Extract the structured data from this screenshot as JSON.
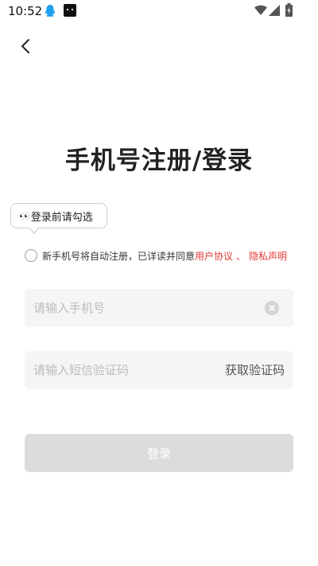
{
  "status_bar": {
    "time": "10:52",
    "icons": [
      "qq-icon",
      "app-icon",
      "wifi-icon",
      "signal-icon",
      "battery-icon"
    ]
  },
  "nav": {
    "back_icon": "chevron-left-icon"
  },
  "title": "手机号注册/登录",
  "tooltip": {
    "eyes": "👀",
    "text": "登录前请勾选"
  },
  "agreement": {
    "text": "新手机号将自动注册，已详读并同意",
    "user_agreement": "用户协议",
    "separator": "、",
    "privacy": "隐私声明",
    "checked": false
  },
  "phone_input": {
    "placeholder": "请输入手机号",
    "value": ""
  },
  "code_input": {
    "placeholder": "请输入短信验证码",
    "value": ""
  },
  "get_code_label": "获取验证码",
  "login_label": "登录",
  "colors": {
    "link": "#e53935",
    "input_bg": "#f5f5f5",
    "button_disabled": "#dcdcdc",
    "qq_icon": "#1ea0f0"
  }
}
